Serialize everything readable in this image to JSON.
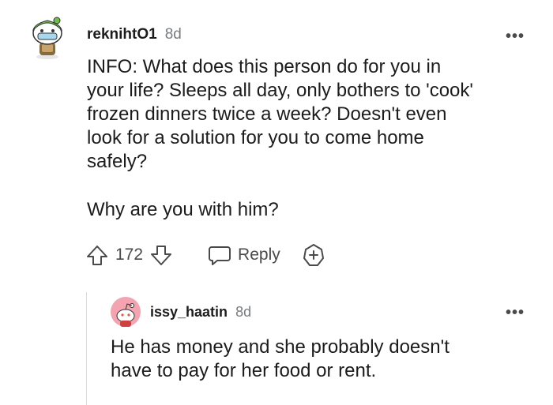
{
  "comment": {
    "username": "reknihtO1",
    "time": "8d",
    "more": "•••",
    "body": [
      "INFO: What does this person do for you in",
      "your life? Sleeps all day, only bothers to 'cook'",
      "frozen dinners twice a week? Doesn't even",
      "look for a solution for you to come home",
      "safely?"
    ],
    "body2": "Why are you with him?",
    "score": "172",
    "reply_label": "Reply",
    "icons": [
      "upvote-icon",
      "downvote-icon",
      "reply-icon",
      "award-icon",
      "avatar"
    ]
  },
  "reply": {
    "username": "issy_haatin",
    "time": "8d",
    "more": "•••",
    "body": [
      "He has money and she probably doesn't",
      "have to pay for her food or rent."
    ],
    "avatar_color": "#f4a3b0"
  }
}
